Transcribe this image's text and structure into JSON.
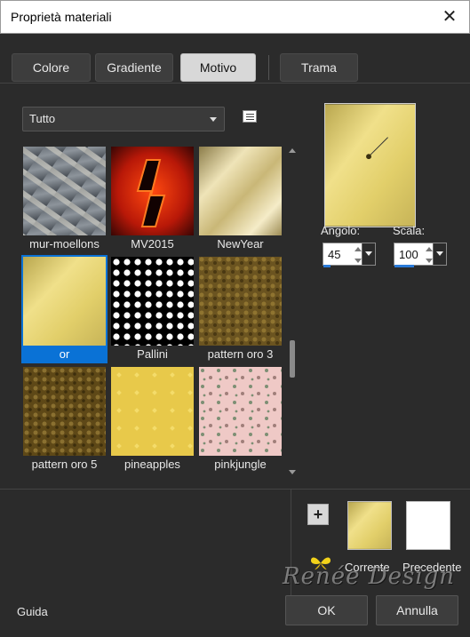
{
  "window": {
    "title": "Proprietà materiali",
    "close_glyph": "✕"
  },
  "tabs": [
    {
      "label": "Colore",
      "active": false
    },
    {
      "label": "Gradiente",
      "active": false
    },
    {
      "label": "Motivo",
      "active": true
    },
    {
      "label": "Trama",
      "active": false
    }
  ],
  "filter": {
    "selected": "Tutto"
  },
  "patterns": [
    {
      "label": "mur-moellons",
      "selected": false
    },
    {
      "label": "MV2015",
      "selected": false
    },
    {
      "label": "NewYear",
      "selected": false
    },
    {
      "label": "or",
      "selected": true
    },
    {
      "label": "Pallini",
      "selected": false
    },
    {
      "label": "pattern oro 3",
      "selected": false
    },
    {
      "label": "pattern oro 5",
      "selected": false
    },
    {
      "label": "pineapples",
      "selected": false
    },
    {
      "label": "pinkjungle",
      "selected": false
    }
  ],
  "angle": {
    "label": "Angolo:",
    "value": "45"
  },
  "scale": {
    "label": "Scala:",
    "value": "100"
  },
  "swatches": {
    "add_glyph": "+",
    "current_label": "Corrente",
    "previous_label": "Precedente"
  },
  "footer": {
    "help_label": "Guida",
    "ok_label": "OK",
    "cancel_label": "Annulla"
  },
  "watermark": "Renée Design",
  "colors": {
    "accent": "#0a72d6",
    "dialog_bg": "#2b2b2b",
    "gold": "#e2cf6a"
  }
}
